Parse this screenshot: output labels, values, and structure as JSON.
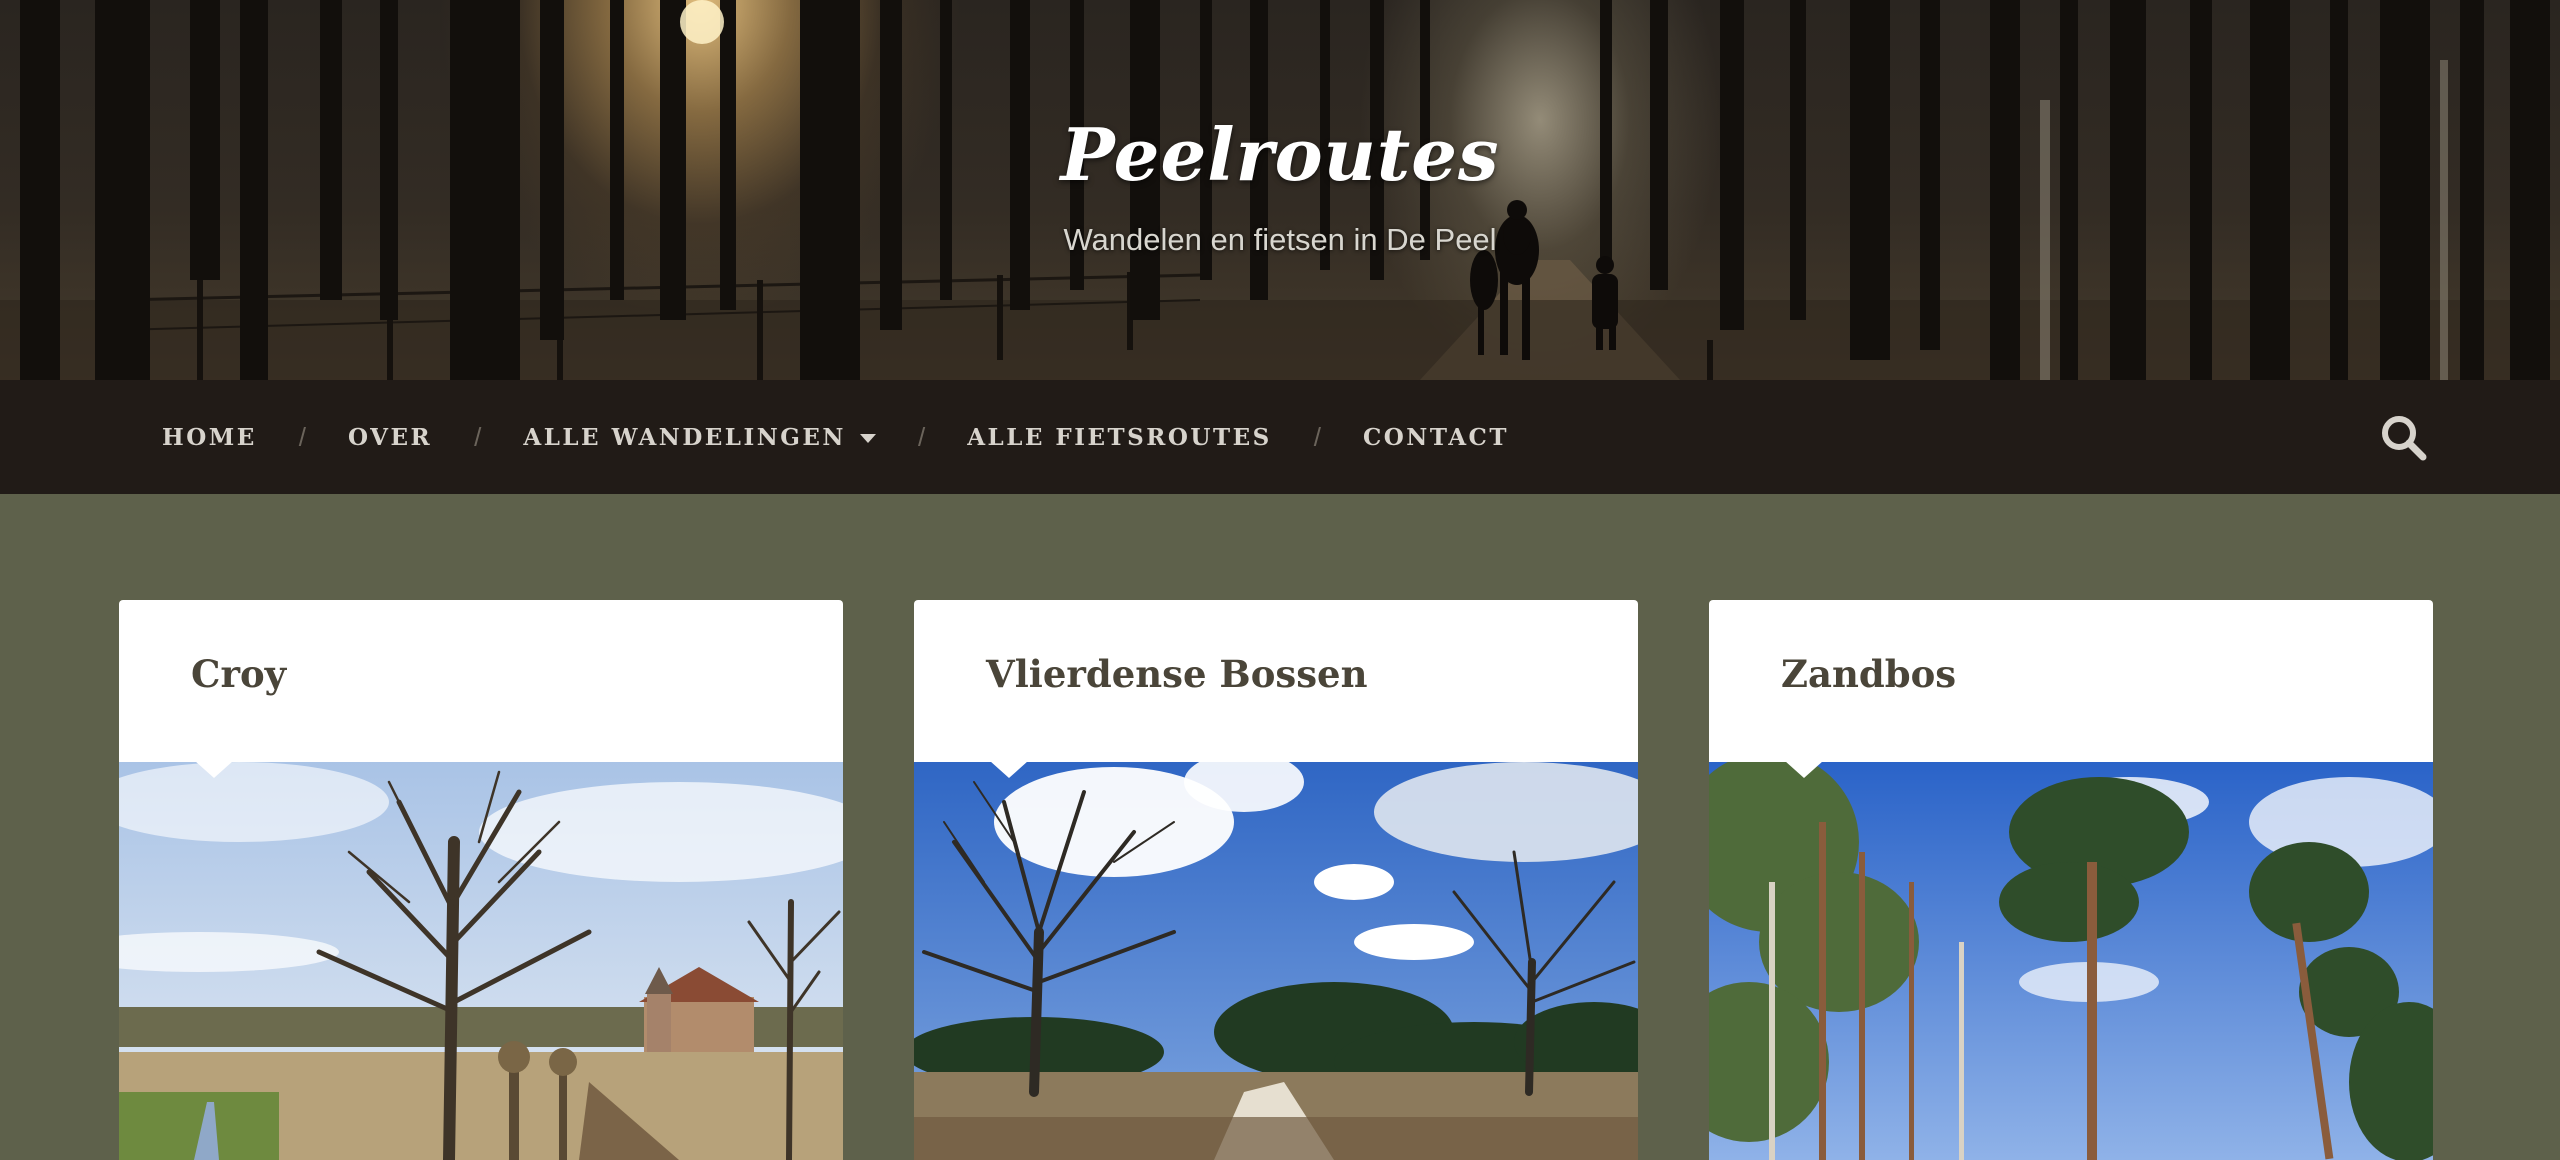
{
  "site": {
    "title": "Peelroutes",
    "tagline": "Wandelen en fietsen in De Peel"
  },
  "nav": {
    "items": [
      {
        "label": "Home"
      },
      {
        "label": "Over"
      },
      {
        "label": "Alle wandelingen",
        "has_dropdown": true
      },
      {
        "label": "Alle fietsroutes"
      },
      {
        "label": "Contact"
      }
    ],
    "separator": "/",
    "search_icon": "search-icon"
  },
  "posts": [
    {
      "title": "Croy",
      "image": "castle-tree-landscape"
    },
    {
      "title": "Vlierdense Bossen",
      "image": "heath-oak-trees-sky"
    },
    {
      "title": "Zandbos",
      "image": "pine-forest-sky"
    }
  ],
  "colors": {
    "background": "#5e614b",
    "nav_background": "#211b17",
    "nav_text": "#d7d3cc",
    "card_title": "#4a4539"
  }
}
